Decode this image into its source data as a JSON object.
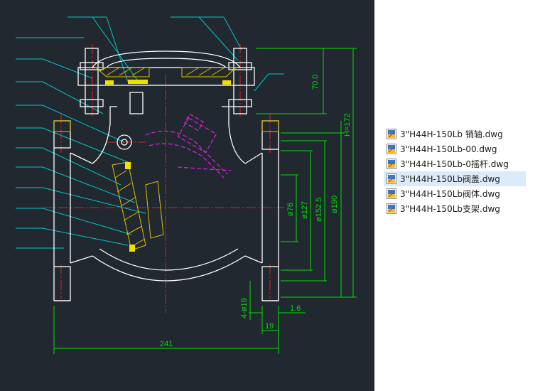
{
  "drawing": {
    "dimensions": {
      "cover_height": "70.0",
      "total_height": "H=172",
      "d1": "ø76",
      "d2": "ø127",
      "d3": "ø152.5",
      "d4": "ø190",
      "bolt_holes": "4-ø19",
      "raised_face": "1.6",
      "flange_thickness": "19",
      "face_to_face": "241"
    }
  },
  "file_list": {
    "items": [
      {
        "name": "3\"H44H-150Lb 销轴.dwg",
        "selected": false
      },
      {
        "name": "3\"H44H-150Lb-00.dwg",
        "selected": false
      },
      {
        "name": "3\"H44H-150Lb-0摇杆.dwg",
        "selected": false
      },
      {
        "name": "3\"H44H-150Lb阀盖.dwg",
        "selected": true
      },
      {
        "name": "3\"H44H-150Lb阀体.dwg",
        "selected": false
      },
      {
        "name": "3\"H44H-150Lb支架.dwg",
        "selected": false
      }
    ],
    "icon": "dwg-file-icon"
  },
  "colors": {
    "canvas": "#212830",
    "outline": "#ffffff",
    "leader": "#00c8c8",
    "dimension": "#00e000",
    "centerline": "#e02020",
    "hatch": "#e0c000",
    "disc_arm": "#e020e0",
    "selection": "#dcebfb"
  }
}
